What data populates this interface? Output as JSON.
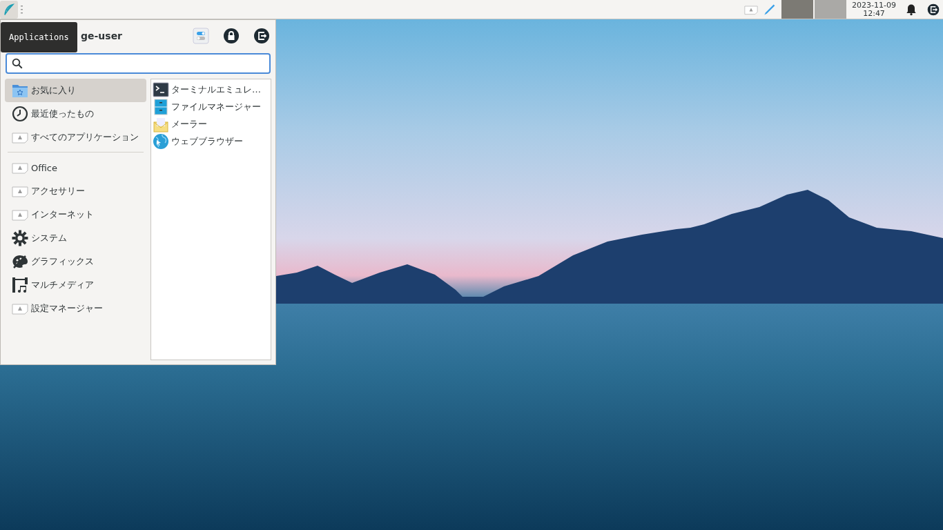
{
  "panel": {
    "tray_windows": [
      {
        "selected": true
      },
      {
        "selected": false
      }
    ],
    "clock": {
      "date": "2023-11-09",
      "time": "12:47"
    }
  },
  "tooltip": "Applications",
  "menu": {
    "username": "ge-user",
    "places": [
      {
        "kind": "folder",
        "label": "お気に入り",
        "selected": true
      },
      {
        "kind": "clock",
        "label": "最近使ったもの",
        "selected": false
      },
      {
        "kind": "missing",
        "label": "すべてのアプリケーション",
        "selected": false
      }
    ],
    "categories": [
      {
        "kind": "missing",
        "label": "Office",
        "selected": false
      },
      {
        "kind": "missing",
        "label": "アクセサリー",
        "selected": false
      },
      {
        "kind": "missing",
        "label": "インターネット",
        "selected": false
      },
      {
        "kind": "gear",
        "label": "システム",
        "selected": false
      },
      {
        "kind": "palette",
        "label": "グラフィックス",
        "selected": false
      },
      {
        "kind": "film",
        "label": "マルチメディア",
        "selected": false
      },
      {
        "kind": "missing",
        "label": "設定マネージャー",
        "selected": false
      }
    ],
    "apps": [
      {
        "kind": "terminal",
        "label": "ターミナルエミュレ…"
      },
      {
        "kind": "files",
        "label": "ファイルマネージャー"
      },
      {
        "kind": "mail",
        "label": "メーラー"
      },
      {
        "kind": "browser",
        "label": "ウェブブラウザー"
      }
    ]
  }
}
